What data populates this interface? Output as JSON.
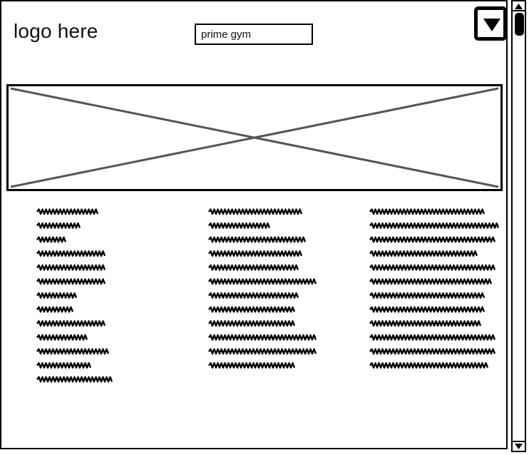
{
  "header": {
    "logo_text": "logo here",
    "search_value": "prime gym",
    "menu_button_icon": "dropdown-triangle-icon"
  },
  "hero": {
    "image_placeholder_icon": "image-placeholder-icon"
  },
  "content": {
    "columns": [
      {
        "line_count": 13
      },
      {
        "line_count": 12
      },
      {
        "line_count": 12
      }
    ]
  },
  "scrollbar": {
    "up_icon": "scroll-up-arrow-icon",
    "down_icon": "scroll-down-arrow-icon"
  },
  "colors": {
    "ink": "#000000",
    "placeholder_line": "#555555",
    "background": "#ffffff"
  }
}
